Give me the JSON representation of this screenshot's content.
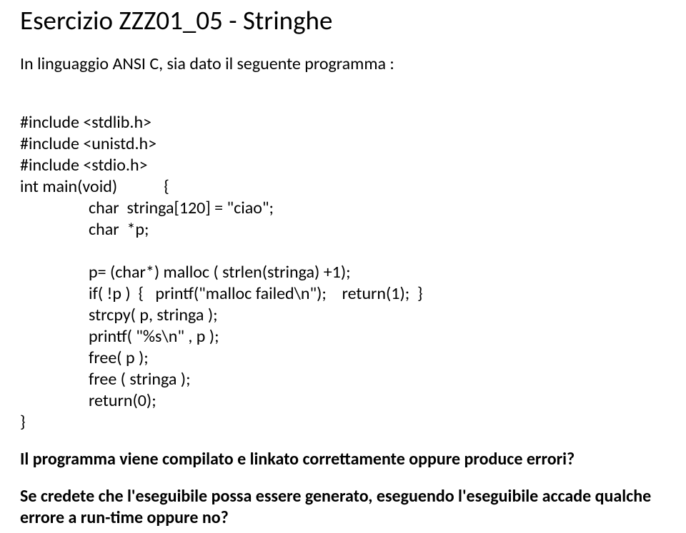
{
  "title": "Esercizio ZZZ01_05 - Stringhe",
  "intro": "In linguaggio ANSI C, sia dato il seguente programma :",
  "code": {
    "l01": "#include <stdlib.h>",
    "l02": "#include <unistd.h>",
    "l03": "#include <stdio.h>",
    "l04a": "int main(void)",
    "l04b": "{",
    "l05": "char  stringa[120] = \"ciao\";",
    "l06": "char  *p;",
    "l07": "p= (char*) malloc ( strlen(stringa) +1);",
    "l08": "if( !p )  {   printf(\"malloc failed\\n\");    return(1);  }",
    "l09": "strcpy( p, stringa );",
    "l10": "printf( \"%s\\n\" , p );",
    "l11": "free( p );",
    "l12": "free ( stringa );",
    "l13": "return(0);",
    "l14": "}"
  },
  "question1": "Il programma viene compilato e linkato correttamente oppure produce errori?",
  "question2": "Se credete che l'eseguibile  possa essere generato, eseguendo l'eseguibile accade qualche errore a run-time oppure no?"
}
